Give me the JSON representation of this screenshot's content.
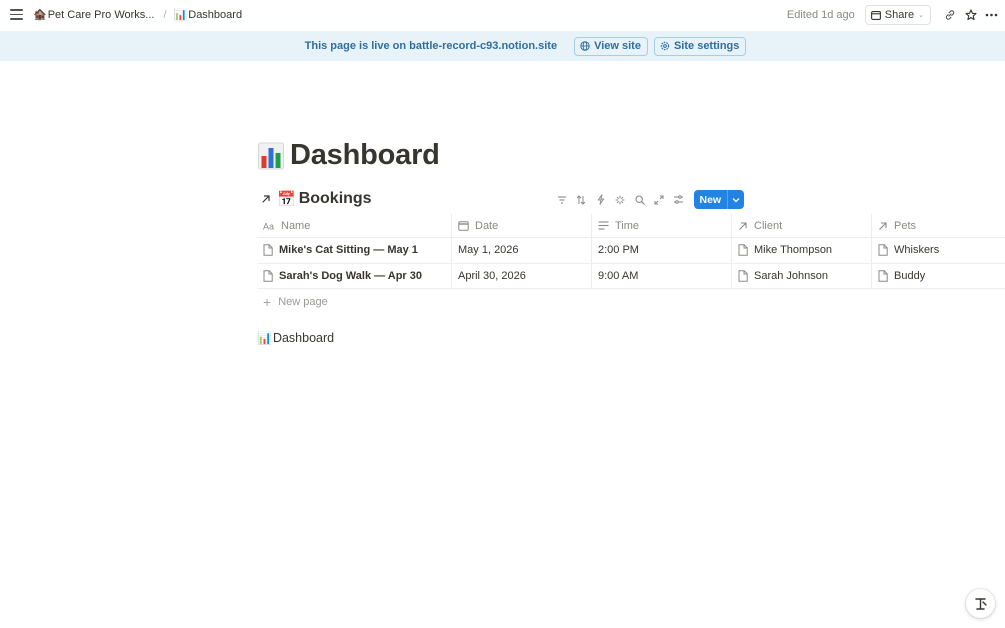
{
  "topbar": {
    "breadcrumbs": [
      {
        "emoji": "🏚️",
        "label": "Pet Care Pro Workspace Ho…",
        "display": "Pet Care Pro Works..."
      },
      {
        "emoji": "📊",
        "label": "Dashboard"
      }
    ],
    "edited": "Edited 1d ago",
    "share_label": "Share"
  },
  "banner": {
    "text": "This page is live on battle-record-c93.notion.site",
    "view_site": "View site",
    "site_settings": "Site settings"
  },
  "page": {
    "title": "Dashboard",
    "title_emoji": "bar-chart-icon"
  },
  "database": {
    "emoji": "📅",
    "title": "Bookings",
    "new_label": "New",
    "columns": [
      {
        "label": "Name",
        "icon": "text-aa-icon"
      },
      {
        "label": "Date",
        "icon": "calendar-icon"
      },
      {
        "label": "Time",
        "icon": "lines-icon"
      },
      {
        "label": "Client",
        "icon": "relation-arrow-icon"
      },
      {
        "label": "Pets",
        "icon": "relation-arrow-icon"
      }
    ],
    "rows": [
      {
        "name": "Mike's Cat Sitting — May 1",
        "date": "May 1, 2026",
        "time": "2:00 PM",
        "client": "Mike Thompson",
        "pets": "Whiskers"
      },
      {
        "name": "Sarah's Dog Walk — Apr 30",
        "date": "April 30, 2026",
        "time": "9:00 AM",
        "client": "Sarah Johnson",
        "pets": "Buddy"
      }
    ],
    "new_page": "New page"
  },
  "link_block": {
    "emoji": "📊",
    "label": "Dashboard"
  },
  "colors": {
    "accent": "#2383e2",
    "banner_bg": "#e7f3f8",
    "banner_text": "#2f6e9e"
  }
}
